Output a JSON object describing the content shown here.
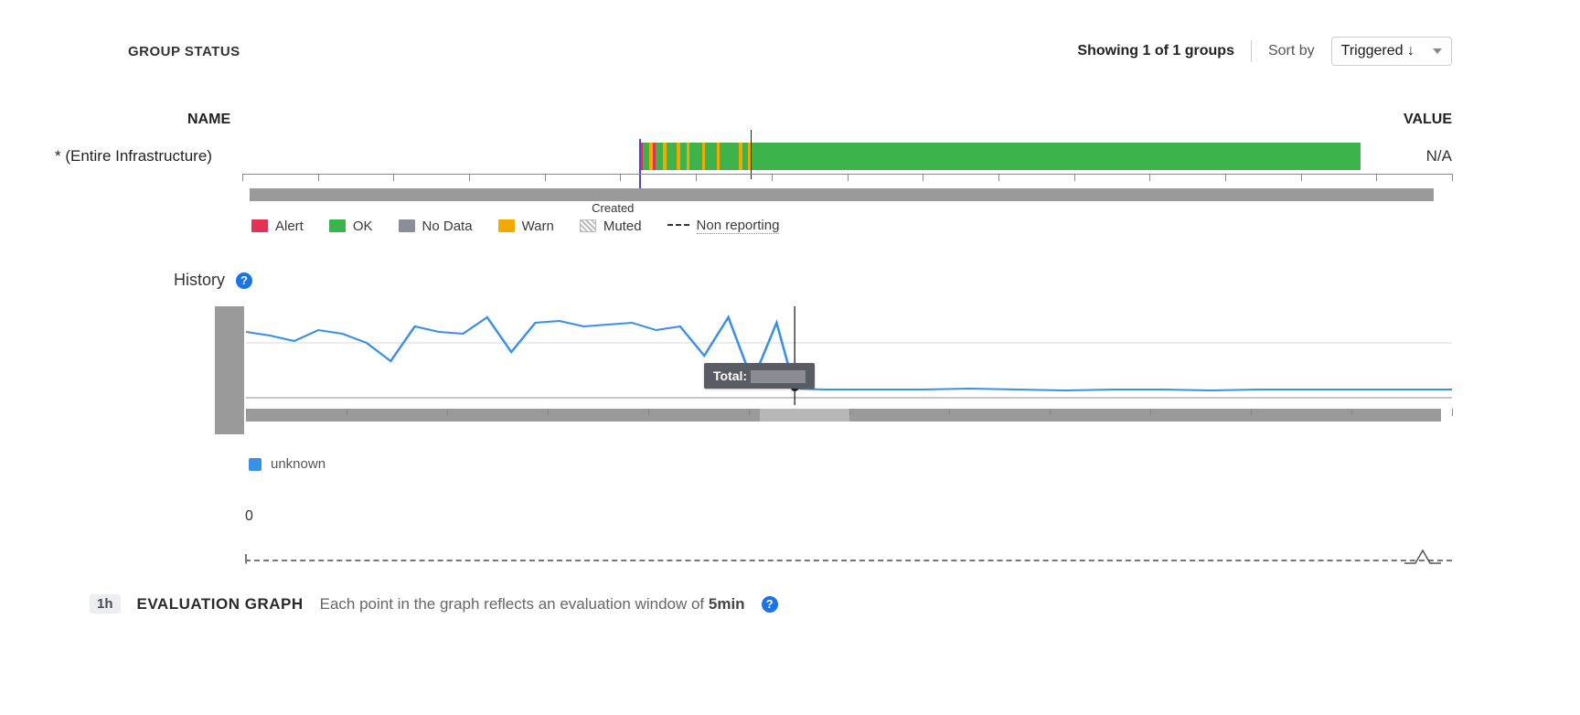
{
  "header": {
    "group_status": "GROUP STATUS",
    "showing": "Showing 1 of 1 groups",
    "sort_by_label": "Sort by",
    "sort_selected": "Triggered ↓"
  },
  "columns": {
    "name": "NAME",
    "value": "VALUE"
  },
  "status_row": {
    "name": "* (Entire Infrastructure)",
    "value": "N/A",
    "created_label": "Created"
  },
  "legend": {
    "alert": "Alert",
    "ok": "OK",
    "no_data": "No Data",
    "warn": "Warn",
    "muted": "Muted",
    "non_reporting": "Non reporting"
  },
  "history": {
    "title": "History",
    "series_name": "unknown",
    "tooltip_label": "Total:"
  },
  "zero": "0",
  "eval": {
    "range": "1h",
    "title": "EVALUATION GRAPH",
    "desc_prefix": "Each point in the graph reflects an evaluation window of ",
    "window": "5min"
  },
  "colors": {
    "alert": "#e33258",
    "ok": "#3cb44b",
    "nodata": "#8b8d99",
    "warn": "#f2a900"
  },
  "status_timeline": {
    "start_pct": 35.5,
    "playhead_pct": 45.5,
    "segments": [
      {
        "c": "alert",
        "l": 35.5,
        "w": 0.35
      },
      {
        "c": "ok",
        "l": 35.85,
        "w": 0.55
      },
      {
        "c": "warn",
        "l": 36.4,
        "w": 0.3
      },
      {
        "c": "alert",
        "l": 36.7,
        "w": 0.25
      },
      {
        "c": "ok",
        "l": 36.95,
        "w": 0.7
      },
      {
        "c": "warn",
        "l": 37.65,
        "w": 0.3
      },
      {
        "c": "ok",
        "l": 37.95,
        "w": 0.9
      },
      {
        "c": "warn",
        "l": 38.85,
        "w": 0.3
      },
      {
        "c": "ok",
        "l": 39.15,
        "w": 0.55
      },
      {
        "c": "warn",
        "l": 39.7,
        "w": 0.3
      },
      {
        "c": "ok",
        "l": 40.0,
        "w": 1.1
      },
      {
        "c": "warn",
        "l": 41.1,
        "w": 0.3
      },
      {
        "c": "ok",
        "l": 41.4,
        "w": 1.0
      },
      {
        "c": "warn",
        "l": 42.4,
        "w": 0.3
      },
      {
        "c": "ok",
        "l": 42.7,
        "w": 1.7
      },
      {
        "c": "warn",
        "l": 44.4,
        "w": 0.3
      },
      {
        "c": "ok",
        "l": 44.7,
        "w": 0.5
      },
      {
        "c": "warn",
        "l": 45.2,
        "w": 0.3
      },
      {
        "c": "ok",
        "l": 45.5,
        "w": 54.5
      }
    ]
  },
  "chart_data": {
    "type": "line",
    "title": "History",
    "xlabel": "",
    "ylabel": "",
    "ylim": [
      0,
      100
    ],
    "playhead_x": 45.5,
    "series": [
      {
        "name": "unknown",
        "color": "#3a8fe6",
        "x": [
          0,
          2,
          4,
          6,
          8,
          10,
          12,
          14,
          16,
          18,
          20,
          22,
          24,
          26,
          28,
          30,
          32,
          34,
          36,
          38,
          40,
          42,
          44,
          45.5,
          48,
          52,
          56,
          60,
          64,
          68,
          72,
          76,
          80,
          84,
          88,
          92,
          96,
          100
        ],
        "values": [
          72,
          68,
          62,
          74,
          70,
          60,
          40,
          78,
          72,
          70,
          88,
          50,
          82,
          84,
          78,
          80,
          82,
          74,
          78,
          46,
          88,
          18,
          82,
          10,
          9,
          9,
          9,
          10,
          9,
          8,
          9,
          9,
          8,
          9,
          9,
          9,
          9,
          9
        ]
      }
    ],
    "scrub_window": {
      "l_pct": 43.0,
      "w_pct": 7.5
    }
  }
}
